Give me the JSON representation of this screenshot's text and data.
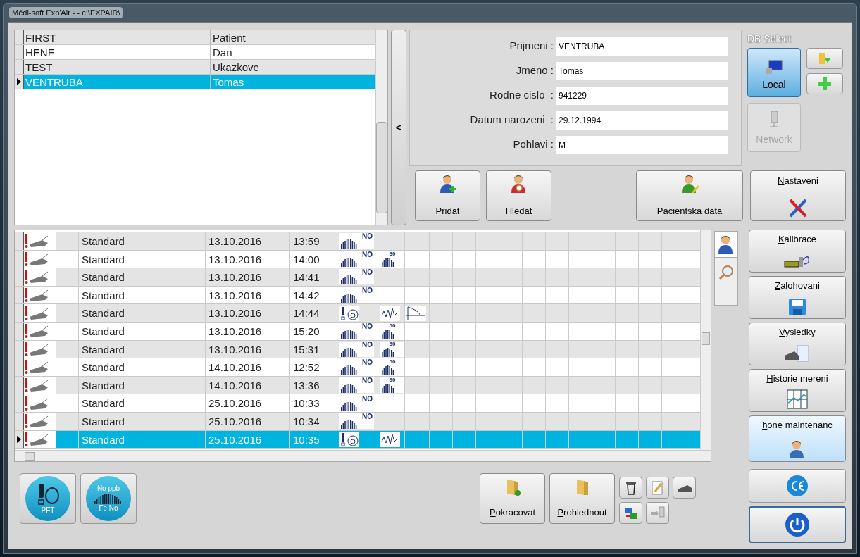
{
  "window": {
    "title": "Médi-soft Exp'Air -  - c:\\EXPAIR\\"
  },
  "patients": {
    "rows": [
      {
        "surname": "FIRST",
        "first_name": "Patient",
        "selected": false
      },
      {
        "surname": "HENE",
        "first_name": "Dan",
        "selected": false
      },
      {
        "surname": "TEST",
        "first_name": "Ukazkove",
        "selected": false
      },
      {
        "surname": "VENTRUBA",
        "first_name": "Tomas",
        "selected": true
      }
    ],
    "collapse": "<"
  },
  "form": {
    "fields": [
      {
        "label": "Prijmeni :",
        "value": "VENTRUBA"
      },
      {
        "label": "Jmeno :",
        "value": "Tomas"
      },
      {
        "label": "Rodne cislo  :",
        "value": "941229"
      },
      {
        "label": "Datum narozeni  :",
        "value": "29.12.1994"
      },
      {
        "label": "Pohlavi :",
        "value": "M"
      }
    ]
  },
  "db_select": {
    "title": "DB Select",
    "sources": [
      {
        "label": "Local",
        "selected": true,
        "disabled": false
      },
      {
        "label": "Network",
        "selected": false,
        "disabled": true
      }
    ]
  },
  "patient_buttons": [
    {
      "label": "Pridat"
    },
    {
      "label": "Hledat"
    },
    {
      "label": "Pacientska data"
    }
  ],
  "measurements": {
    "rows": [
      {
        "type": "Standard",
        "date": "13.10.2016",
        "time": "13:59",
        "selected": false,
        "cells": [
          {
            "kind": "feno",
            "label": "NO"
          }
        ]
      },
      {
        "type": "Standard",
        "date": "13.10.2016",
        "time": "14:00",
        "selected": false,
        "cells": [
          {
            "kind": "feno",
            "label": "NO"
          },
          {
            "kind": "flow",
            "label": "50"
          }
        ]
      },
      {
        "type": "Standard",
        "date": "13.10.2016",
        "time": "14:41",
        "selected": false,
        "cells": [
          {
            "kind": "feno",
            "label": "NO"
          }
        ]
      },
      {
        "type": "Standard",
        "date": "13.10.2016",
        "time": "14:42",
        "selected": false,
        "cells": [
          {
            "kind": "feno",
            "label": "NO"
          }
        ]
      },
      {
        "type": "Standard",
        "date": "13.10.2016",
        "time": "14:44",
        "selected": false,
        "cells": [
          {
            "kind": "pft"
          },
          {
            "kind": "wave"
          },
          {
            "kind": "loop"
          }
        ]
      },
      {
        "type": "Standard",
        "date": "13.10.2016",
        "time": "15:20",
        "selected": false,
        "cells": [
          {
            "kind": "feno",
            "label": "NO"
          },
          {
            "kind": "flow",
            "label": "50"
          }
        ]
      },
      {
        "type": "Standard",
        "date": "13.10.2016",
        "time": "15:31",
        "selected": false,
        "cells": [
          {
            "kind": "feno",
            "label": "NO"
          },
          {
            "kind": "flow",
            "label": "50"
          }
        ]
      },
      {
        "type": "Standard",
        "date": "14.10.2016",
        "time": "12:52",
        "selected": false,
        "cells": [
          {
            "kind": "feno",
            "label": "NO"
          },
          {
            "kind": "flow",
            "label": "50"
          }
        ]
      },
      {
        "type": "Standard",
        "date": "14.10.2016",
        "time": "13:36",
        "selected": false,
        "cells": [
          {
            "kind": "feno",
            "label": "NO"
          },
          {
            "kind": "flow",
            "label": "50"
          }
        ]
      },
      {
        "type": "Standard",
        "date": "25.10.2016",
        "time": "10:33",
        "selected": false,
        "cells": [
          {
            "kind": "feno",
            "label": "NO"
          }
        ]
      },
      {
        "type": "Standard",
        "date": "25.10.2016",
        "time": "10:34",
        "selected": false,
        "cells": [
          {
            "kind": "feno",
            "label": "NO"
          }
        ]
      },
      {
        "type": "Standard",
        "date": "25.10.2016",
        "time": "10:35",
        "selected": true,
        "cells": [
          {
            "kind": "pft"
          },
          {
            "kind": "wave"
          }
        ]
      }
    ]
  },
  "side_menu": [
    {
      "label": "Nastaveni"
    },
    {
      "label": "Kalibrace"
    },
    {
      "label": "Zalohovani"
    },
    {
      "label": "Vysledky"
    },
    {
      "label": "Historie mereni"
    },
    {
      "label": "hone maintenanc"
    }
  ],
  "test_buttons": [
    {
      "kind": "pft",
      "labels": [
        "PFT"
      ]
    },
    {
      "kind": "feno",
      "labels": [
        "No ppb",
        "Fe No"
      ]
    }
  ],
  "action_buttons": [
    {
      "label": "Pokracovat"
    },
    {
      "label": "Prohlednout"
    }
  ]
}
